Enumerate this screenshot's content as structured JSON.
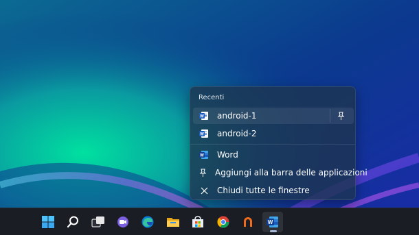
{
  "jumplist": {
    "section_title": "Recenti",
    "recent_items": [
      {
        "label": "android-1",
        "icon": "word-doc-icon"
      },
      {
        "label": "android-2",
        "icon": "word-doc-icon"
      }
    ],
    "tasks": [
      {
        "label": "Word",
        "icon": "word-app-icon"
      },
      {
        "label": "Aggiungi alla barra delle applicazioni",
        "icon": "pin-icon"
      },
      {
        "label": "Chiudi tutte le finestre",
        "icon": "close-icon"
      }
    ]
  },
  "taskbar": {
    "items": [
      {
        "name": "start",
        "icon": "windows-logo-icon"
      },
      {
        "name": "search",
        "icon": "search-icon"
      },
      {
        "name": "task-view",
        "icon": "task-view-icon"
      },
      {
        "name": "chat",
        "icon": "teams-chat-icon"
      },
      {
        "name": "edge",
        "icon": "edge-icon"
      },
      {
        "name": "file-explorer",
        "icon": "folder-icon"
      },
      {
        "name": "store",
        "icon": "store-icon"
      },
      {
        "name": "chrome",
        "icon": "chrome-icon"
      },
      {
        "name": "app",
        "icon": "orange-app-icon"
      },
      {
        "name": "word",
        "icon": "word-app-icon",
        "active": true
      }
    ]
  },
  "colors": {
    "word_blue": "#185abd",
    "taskbar_bg": "#1a1d24",
    "accent": "#0078d4"
  }
}
